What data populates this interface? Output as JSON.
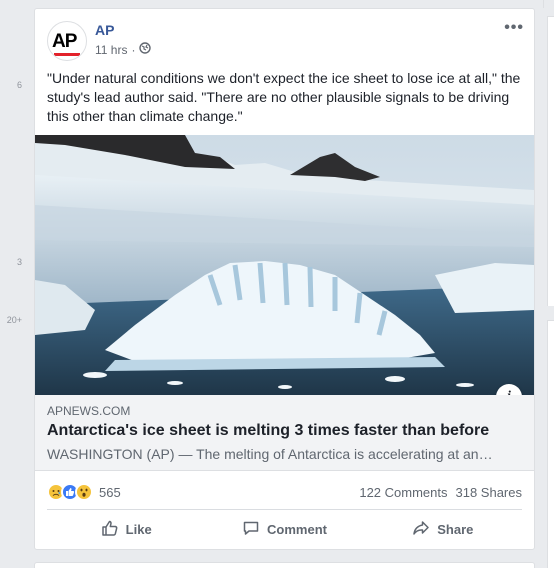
{
  "left_counts": [
    "6",
    "3",
    "20+"
  ],
  "post": {
    "author": "AP",
    "avatar_text": "AP",
    "time": "11 hrs",
    "privacy_sep": "·",
    "text": "\"Under natural conditions we don't expect the ice sheet to lose ice at all,\" the study's lead author said. \"There are no other plausible signals to be driving this other than climate change.\"",
    "link": {
      "domain": "APNEWS.COM",
      "title": "Antarctica's ice sheet is melting 3 times faster than before",
      "description": "WASHINGTON (AP) — The melting of Antarctica is accelerating at an…"
    },
    "info_glyph": "i",
    "reactions": {
      "icons": [
        "sad-icon",
        "like-icon",
        "wow-icon"
      ],
      "count": "565"
    },
    "comments": "122 Comments",
    "shares": "318 Shares",
    "actions": {
      "like": "Like",
      "comment": "Comment",
      "share": "Share"
    }
  },
  "colors": {
    "link_blue": "#385898",
    "ap_red": "#e2212a",
    "like_blue": "#3b7af5",
    "emoji_yellow": "#f5c33b"
  }
}
